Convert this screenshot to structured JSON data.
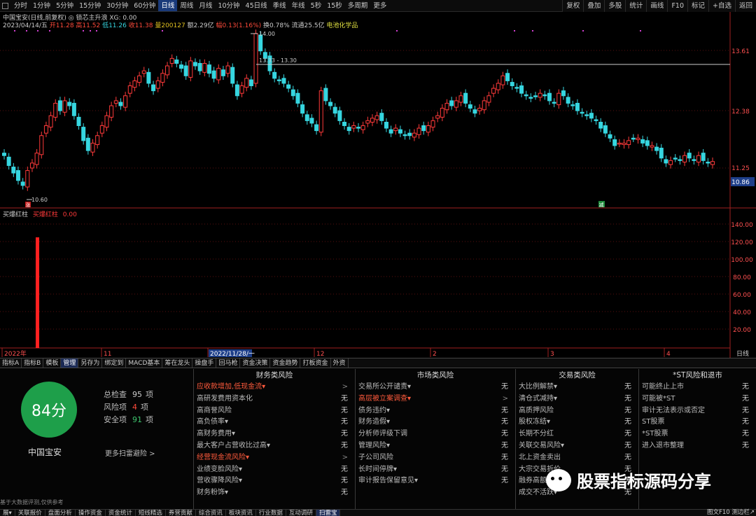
{
  "toolbar": {
    "periods": [
      "分时",
      "1分钟",
      "5分钟",
      "15分钟",
      "30分钟",
      "60分钟",
      "日线",
      "周线",
      "月线",
      "10分钟",
      "45日线",
      "季线",
      "年线",
      "5秒",
      "15秒",
      "多周期",
      "更多"
    ],
    "active_period": "日线",
    "right_buttons": [
      "复权",
      "叠加",
      "多股",
      "统计",
      "画线",
      "F10",
      "标记",
      "+自选",
      "返回"
    ]
  },
  "info": {
    "line1": "中国宝安(日线,前复权) ◎ 锁芯主升浪 XG: 0.00",
    "date": "2023/04/14/五",
    "open": "开11.28",
    "high": "高11.52",
    "low": "低11.26",
    "close": "收11.38",
    "volume": "量200127",
    "amount": "额2.29亿",
    "change": "幅0.13(1.16%)",
    "turnover": "换0.78%",
    "float": "流通25.5亿",
    "sector": "电池化学品"
  },
  "price_chart": {
    "price_labels": [
      "13.61",
      "12.38",
      "11.25",
      "10.86"
    ],
    "annotations": {
      "high_label": "14.00",
      "low_label": "10.60",
      "range_label": "13.33 - 13.30"
    },
    "markers": {
      "up": "涨",
      "down": "减"
    }
  },
  "indicator": {
    "title": "买爆红柱",
    "value_label": "买爆红柱",
    "value": "0.00",
    "axis_labels": [
      "140.00",
      "120.00",
      "100.00",
      "80.00",
      "60.00",
      "40.00",
      "20.00"
    ]
  },
  "time_axis": {
    "labels": [
      "2022年",
      "11",
      "2022/11/28/一",
      "12",
      "2",
      "3",
      "4"
    ],
    "right_label": "日线"
  },
  "tabs": {
    "items": [
      "指标A",
      "指标B",
      "模板",
      "管理",
      "另存为",
      "绑定到",
      "MACD基本",
      "筹在龙头",
      "操盘手",
      "回马枪",
      "资金决策",
      "资金趋势",
      "打板资金",
      "外资"
    ],
    "active": "管理"
  },
  "risk": {
    "score": "84分",
    "stock": "中国宝安",
    "stats": [
      {
        "label": "总检查",
        "count": "95",
        "unit": "项",
        "color": "#cccccc"
      },
      {
        "label": "风险项",
        "count": "4",
        "unit": "项",
        "color": "#ff4a3a"
      },
      {
        "label": "安全项",
        "count": "91",
        "unit": "项",
        "color": "#3ec46e"
      }
    ],
    "more": "更多扫雷避险 >",
    "columns": [
      {
        "title": "财务类风险",
        "rows": [
          [
            "应收款增加,低现金流▾",
            ">",
            "red"
          ],
          [
            "高研发费用资本化",
            "无",
            ""
          ],
          [
            "高商誉风险",
            "无",
            ""
          ],
          [
            "高负债率▾",
            "无",
            ""
          ],
          [
            "高财务费用▾",
            "无",
            ""
          ],
          [
            "最大客户占营收比过高▾",
            "无",
            ""
          ],
          [
            "经营现金流风险▾",
            ">",
            "red"
          ],
          [
            "业绩变脸风险▾",
            "无",
            ""
          ],
          [
            "营收骤降风险▾",
            "无",
            ""
          ],
          [
            "财务粉饰▾",
            "无",
            ""
          ]
        ]
      },
      {
        "title": "市场类风险",
        "rows": [
          [
            "交易所公开谴责▾",
            "无",
            ""
          ],
          [
            "高层被立案调查▾",
            ">",
            "red"
          ],
          [
            "债务违约▾",
            "无",
            ""
          ],
          [
            "财务造假▾",
            "无",
            ""
          ],
          [
            "分析师评级下调",
            "无",
            ""
          ],
          [
            "管理风险▾",
            "无",
            ""
          ],
          [
            "子公司风险",
            "无",
            ""
          ],
          [
            "长时间停牌▾",
            "无",
            ""
          ],
          [
            "审计报告保留意见▾",
            "无",
            ""
          ]
        ]
      },
      {
        "title": "交易类风险",
        "rows": [
          [
            "大比例解禁▾",
            "无",
            ""
          ],
          [
            "清仓式减持▾",
            "无",
            ""
          ],
          [
            "高质押风险",
            "无",
            ""
          ],
          [
            "股权冻结▾",
            "无",
            ""
          ],
          [
            "长期不分红",
            "无",
            ""
          ],
          [
            "关联交易风险▾",
            "无",
            ""
          ],
          [
            "北上资金卖出",
            "无",
            ""
          ],
          [
            "大宗交易折价",
            "无",
            ""
          ],
          [
            "融券高额卖出",
            "无",
            ""
          ],
          [
            "成交不活跃▾",
            "无",
            ""
          ]
        ]
      },
      {
        "title": "*ST风险和退市",
        "rows": [
          [
            "可能终止上市",
            "无",
            ""
          ],
          [
            "可能被*ST",
            "无",
            ""
          ],
          [
            "审计无法表示或否定",
            "无",
            ""
          ],
          [
            "ST股票",
            "无",
            ""
          ],
          [
            "*ST股票",
            "无",
            ""
          ],
          [
            "进入退市整理",
            "无",
            ""
          ]
        ]
      }
    ]
  },
  "disclaimer": "基于大数据评测,仅供参考",
  "bottombar": {
    "items": [
      "展▾",
      "关联报价",
      "盘面分析",
      "操作资金",
      "资金统计",
      "短线精选",
      "券营贡献",
      "综合资讯",
      "板块资讯",
      "行业数据",
      "互动调研",
      "扫雷宝"
    ],
    "active": "扫雷宝",
    "right": "图文F10  测边栏↗"
  },
  "watermark": "股票指标源码分享",
  "colors": {
    "up": "#ff3a3a",
    "down": "#36d6e0",
    "grid": "#5a1010",
    "bg": "#000000"
  }
}
